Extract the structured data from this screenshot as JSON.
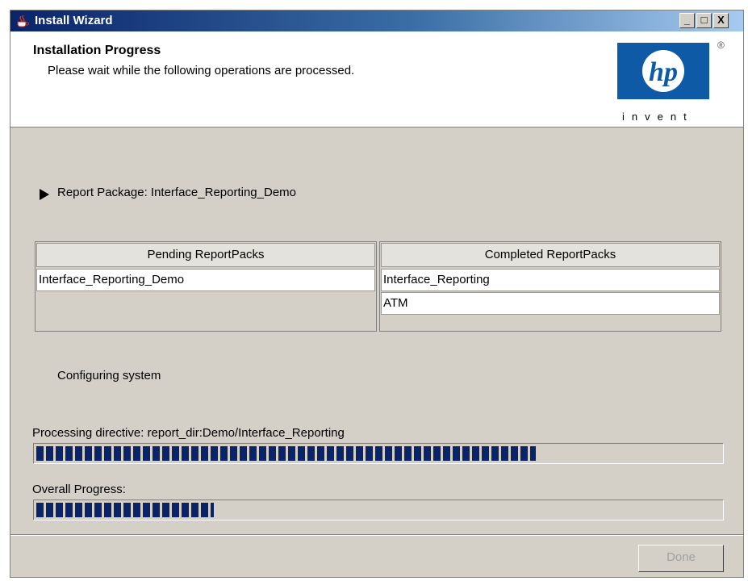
{
  "window": {
    "title": "Install Wizard",
    "controls": {
      "minimize": "_",
      "maximize": "□",
      "close": "X"
    }
  },
  "header": {
    "title": "Installation Progress",
    "subtitle": "Please wait while the following operations are processed.",
    "logo": {
      "brand": "hp",
      "tagline": "invent",
      "registered": "®"
    }
  },
  "package": {
    "icon": "play-arrow-icon",
    "label": "Report Package: Interface_Reporting_Demo"
  },
  "pending": {
    "header": "Pending ReportPacks",
    "rows": [
      "Interface_Reporting_Demo"
    ]
  },
  "completed": {
    "header": "Completed ReportPacks",
    "rows": [
      "Interface_Reporting",
      "ATM"
    ]
  },
  "status": "Configuring system",
  "directive": {
    "label": "Processing directive: report_dir:Demo/Interface_Reporting",
    "progress_fraction": 0.73
  },
  "overall": {
    "label": "Overall Progress:",
    "progress_fraction": 0.26
  },
  "buttons": {
    "done": "Done"
  },
  "colors": {
    "accent": "#0a246a",
    "hp_blue": "#0e5aa7"
  }
}
